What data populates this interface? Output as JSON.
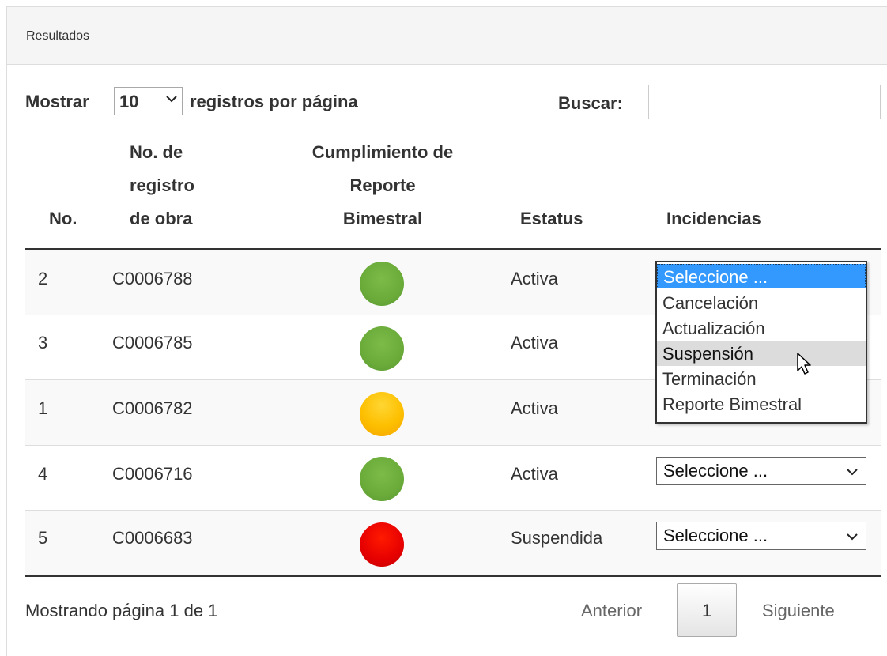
{
  "panel": {
    "heading": "Resultados"
  },
  "controls": {
    "show_label": "Mostrar",
    "page_length": "10",
    "per_page_label": "registros por página",
    "search_label": "Buscar:",
    "search_value": ""
  },
  "table": {
    "headers": {
      "no": "No.",
      "registro_l1": "No. de",
      "registro_l2": "registro",
      "registro_l3": "de obra",
      "cumpl_l1": "Cumplimiento de",
      "cumpl_l2": "Reporte",
      "cumpl_l3": "Bimestral",
      "estatus": "Estatus",
      "incidencias": "Incidencias"
    },
    "rows": [
      {
        "no": "2",
        "registro": "C0006788",
        "cumplimiento": "green",
        "estatus": "Activa",
        "incidencia": "Seleccione ..."
      },
      {
        "no": "3",
        "registro": "C0006785",
        "cumplimiento": "green",
        "estatus": "Activa",
        "incidencia": "Seleccione ..."
      },
      {
        "no": "1",
        "registro": "C0006782",
        "cumplimiento": "yellow",
        "estatus": "Activa",
        "incidencia": "Seleccione ..."
      },
      {
        "no": "4",
        "registro": "C0006716",
        "cumplimiento": "green",
        "estatus": "Activa",
        "incidencia": "Seleccione ..."
      },
      {
        "no": "5",
        "registro": "C0006683",
        "cumplimiento": "red",
        "estatus": "Suspendida",
        "incidencia": "Seleccione ..."
      }
    ]
  },
  "dropdown": {
    "options": [
      "Seleccione ...",
      "Cancelación",
      "Actualización",
      "Suspensión",
      "Terminación",
      "Reporte Bimestral"
    ],
    "selected_index": 0,
    "hover_index": 3
  },
  "footer": {
    "info": "Mostrando página 1 de 1",
    "prev": "Anterior",
    "current_page": "1",
    "next": "Siguiente"
  },
  "colors": {
    "green": "#6aab3a",
    "yellow": "#fdbf00",
    "red": "#e60000",
    "option_selected": "#3399ff",
    "option_hover": "#dcdcdc"
  },
  "icons": {
    "select_arrow": "chevron-down-icon",
    "pointer": "mouse-cursor-icon"
  }
}
